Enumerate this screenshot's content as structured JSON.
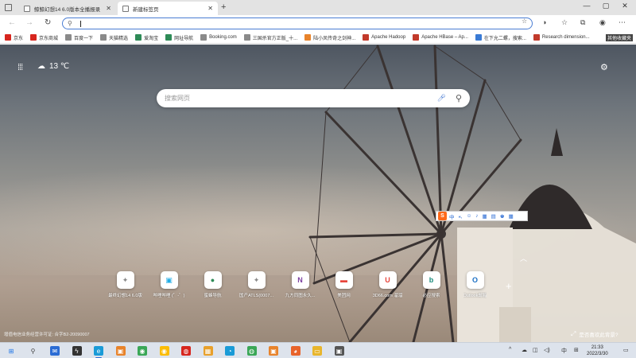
{
  "browser": {
    "tabs": [
      {
        "label": "鲸鲸幻想14 6.0版本全播报录",
        "active": false
      },
      {
        "label": "新建标签页",
        "active": true
      }
    ],
    "address_value": ""
  },
  "bookmarks": [
    {
      "label": "京东",
      "color": "#d7261e"
    },
    {
      "label": "京东商城",
      "color": "#d7261e"
    },
    {
      "label": "百度一下",
      "color": "#8a8a8a"
    },
    {
      "label": "天猫精选",
      "color": "#8a8a8a"
    },
    {
      "label": "爱淘宝",
      "color": "#2e8b57"
    },
    {
      "label": "网址导航",
      "color": "#2e8b57"
    },
    {
      "label": "Booking.com",
      "color": "#8a8a8a"
    },
    {
      "label": "三国杀官方正版_十...",
      "color": "#8a8a8a"
    },
    {
      "label": "陆小凤传奇之剑神...",
      "color": "#e8832b"
    },
    {
      "label": "Apache Hadoop",
      "color": "#c23a2b"
    },
    {
      "label": "Apache HBase – Ap...",
      "color": "#c23a2b"
    },
    {
      "label": "在下允二螺，搜索...",
      "color": "#3a7bd5"
    },
    {
      "label": "Research dimension...",
      "color": "#c23a2b"
    }
  ],
  "bookmarks_overflow": "其他收藏夹",
  "ntp": {
    "weather": {
      "temperature": "13 ℃"
    },
    "search_placeholder": "搜索网页",
    "quick_links": [
      {
        "label": "最终幻想14 6.0版",
        "glyph": "✦",
        "color": "#8a8a8a"
      },
      {
        "label": "哔哩哔哩 (゜-゜)",
        "glyph": "▣",
        "color": "#23ade5"
      },
      {
        "label": "蜜蜂导航",
        "glyph": "●",
        "color": "#2e8b57"
      },
      {
        "label": "国产ATLS(0007...",
        "glyph": "✦",
        "color": "#8a8a8a"
      },
      {
        "label": "九方同图永久...",
        "glyph": "N",
        "color": "#7b3fa0"
      },
      {
        "label": "美团网",
        "glyph": "▬",
        "color": "#e8453c"
      },
      {
        "label": "3D66.com 溜溜",
        "glyph": "U",
        "color": "#e8453c"
      },
      {
        "label": "必应搜索",
        "glyph": "b",
        "color": "#178a7a"
      },
      {
        "label": "Outlook邮箱",
        "glyph": "O",
        "color": "#1a6fc4"
      }
    ],
    "license_text": "增值电信业务经营许可证: 合字B2-20090007",
    "background_prompt": "是否喜欢此背景?"
  },
  "ime_toolbar": {
    "items": [
      "中",
      "⁎,",
      "☺",
      "♪",
      "▦",
      "▤",
      "♚",
      "▦"
    ]
  },
  "taskbar": {
    "tray": {
      "expand": "^",
      "lang": "中"
    },
    "clock": {
      "time": "21:33",
      "date": "2022/3/30"
    },
    "apps": [
      {
        "name": "start-icon",
        "color": "#1a73e8"
      },
      {
        "name": "search-icon",
        "color": "#444444"
      },
      {
        "name": "mail-icon",
        "color": "#2b6cd4"
      },
      {
        "name": "app-icon",
        "color": "#333333"
      },
      {
        "name": "edge-icon",
        "color": "#1a9bd7"
      },
      {
        "name": "game-icon",
        "color": "#e8832b"
      },
      {
        "name": "chrome-icon",
        "color": "#3aa757"
      },
      {
        "name": "chrome-alt-icon",
        "color": "#fbbc05"
      },
      {
        "name": "weibo-icon",
        "color": "#d7261e"
      },
      {
        "name": "photos-icon",
        "color": "#e8a02b"
      },
      {
        "name": "qq-browser-icon",
        "color": "#1a9bd7"
      },
      {
        "name": "wechat-icon",
        "color": "#3aa757"
      },
      {
        "name": "game2-icon",
        "color": "#e8832b"
      },
      {
        "name": "firefox-icon",
        "color": "#e8632b"
      },
      {
        "name": "files-icon",
        "color": "#e8b52b"
      },
      {
        "name": "app2-icon",
        "color": "#555555"
      }
    ]
  }
}
